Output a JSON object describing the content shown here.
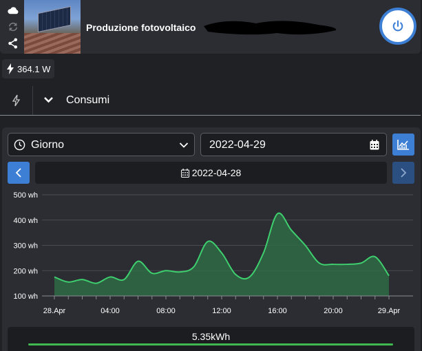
{
  "header": {
    "title": "Produzione fotovoltaico",
    "icons": [
      "cloud-icon",
      "sync-icon",
      "share-icon"
    ],
    "power_button_color": "#3d7fd4"
  },
  "power_badge": {
    "value": "364.1 W"
  },
  "section": {
    "label": "Consumi"
  },
  "controls": {
    "period": "Giorno",
    "date_input": "2022-04-29",
    "selected_date": "2022-04-28"
  },
  "chart_data": {
    "type": "area",
    "color": "#3ecf6e",
    "fill": "#2f6b45",
    "y_ticks": [
      "100 wh",
      "200 wh",
      "300 wh",
      "400 wh",
      "500 wh"
    ],
    "ylim": [
      100,
      500
    ],
    "x_ticks": [
      "28.Apr",
      "04:00",
      "08:00",
      "12:00",
      "16:00",
      "20:00",
      "29.Apr"
    ],
    "x_tick_hours": [
      0,
      4,
      8,
      12,
      16,
      20,
      24
    ],
    "x": [
      0,
      1,
      2,
      3,
      4,
      5,
      6,
      7,
      8,
      9,
      10,
      11,
      12,
      13,
      14,
      15,
      16,
      17,
      18,
      19,
      20,
      21,
      22,
      23,
      24
    ],
    "values": [
      175,
      155,
      165,
      150,
      175,
      165,
      237,
      190,
      200,
      195,
      215,
      315,
      270,
      185,
      175,
      270,
      425,
      360,
      300,
      230,
      225,
      225,
      230,
      255,
      180
    ],
    "grid": true
  },
  "total": {
    "value": "5.35kWh"
  }
}
